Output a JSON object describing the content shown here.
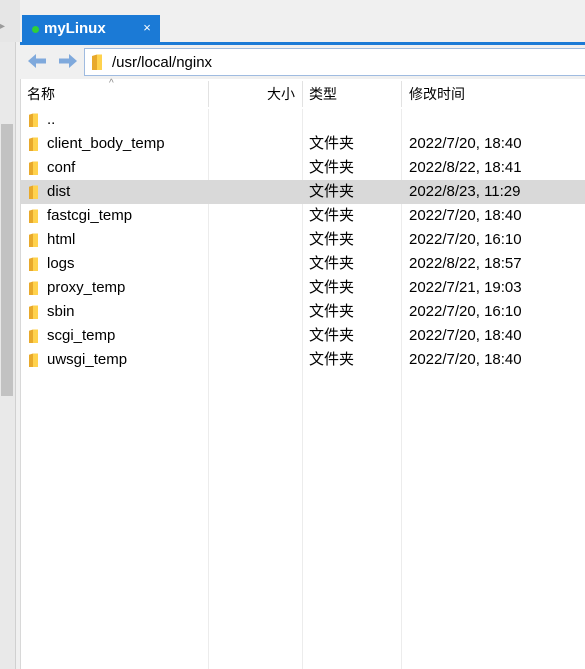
{
  "tab": {
    "title": "myLinux",
    "close_glyph": "×",
    "status_color": "#2fcf3a",
    "accent_color": "#1b7ad6"
  },
  "toolbar": {
    "back_icon": "arrow-left-icon",
    "forward_icon": "arrow-right-icon",
    "path": "/usr/local/nginx"
  },
  "list": {
    "columns": {
      "name": "名称",
      "size": "大小",
      "type": "类型",
      "modified": "修改时间"
    },
    "rows": [
      {
        "name": "..",
        "type": "",
        "modified": ""
      },
      {
        "name": "client_body_temp",
        "type": "文件夹",
        "modified": "2022/7/20, 18:40"
      },
      {
        "name": "conf",
        "type": "文件夹",
        "modified": "2022/8/22, 18:41"
      },
      {
        "name": "dist",
        "type": "文件夹",
        "modified": "2022/8/23, 11:29"
      },
      {
        "name": "fastcgi_temp",
        "type": "文件夹",
        "modified": "2022/7/20, 18:40"
      },
      {
        "name": "html",
        "type": "文件夹",
        "modified": "2022/7/20, 16:10"
      },
      {
        "name": "logs",
        "type": "文件夹",
        "modified": "2022/8/22, 18:57"
      },
      {
        "name": "proxy_temp",
        "type": "文件夹",
        "modified": "2022/7/21, 19:03"
      },
      {
        "name": "sbin",
        "type": "文件夹",
        "modified": "2022/7/20, 16:10"
      },
      {
        "name": "scgi_temp",
        "type": "文件夹",
        "modified": "2022/7/20, 18:40"
      },
      {
        "name": "uwsgi_temp",
        "type": "文件夹",
        "modified": "2022/7/20, 18:40"
      }
    ],
    "selected_row": "dist"
  }
}
